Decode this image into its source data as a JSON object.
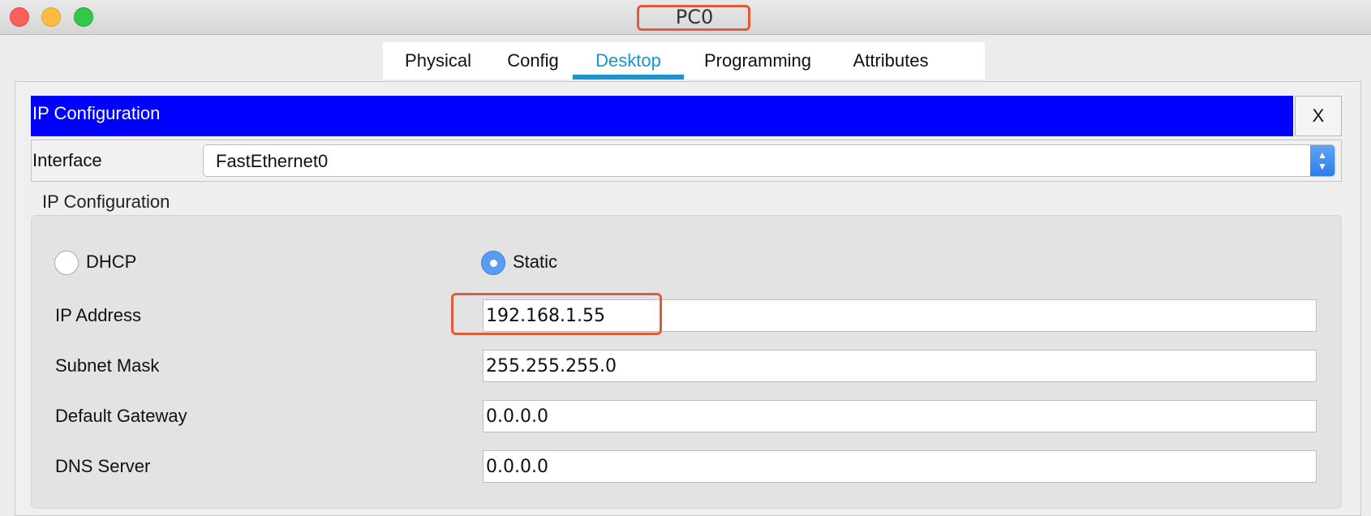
{
  "window": {
    "title": "PC0",
    "highlight_color": "#e05a3c"
  },
  "tabs": [
    {
      "label": "Physical",
      "active": false
    },
    {
      "label": "Config",
      "active": false
    },
    {
      "label": "Desktop",
      "active": true
    },
    {
      "label": "Programming",
      "active": false
    },
    {
      "label": "Attributes",
      "active": false
    }
  ],
  "app": {
    "title": "IP Configuration",
    "close_label": "X",
    "header_color": "#0000ff",
    "accent_color": "#1a93d1"
  },
  "interface": {
    "label": "Interface",
    "selected": "FastEthernet0",
    "arrows_icon": "up-down-chevron-icon"
  },
  "ip_config": {
    "section_title": "IP Configuration",
    "mode_options": [
      {
        "label": "DHCP",
        "selected": false
      },
      {
        "label": "Static",
        "selected": true
      }
    ],
    "fields": [
      {
        "label": "IP Address",
        "value": "192.168.1.55"
      },
      {
        "label": "Subnet Mask",
        "value": "255.255.255.0"
      },
      {
        "label": "Default Gateway",
        "value": "0.0.0.0"
      },
      {
        "label": "DNS Server",
        "value": "0.0.0.0"
      }
    ]
  }
}
